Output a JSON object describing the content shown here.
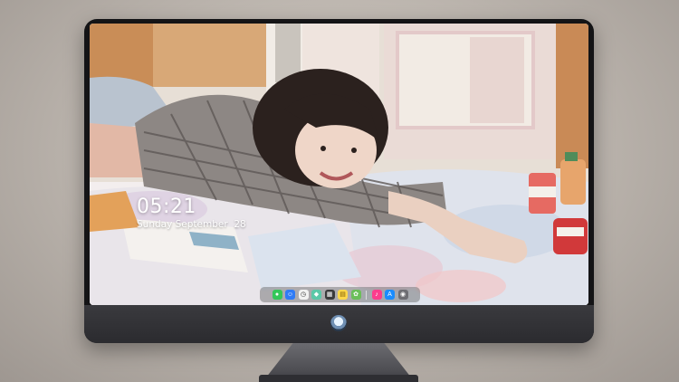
{
  "lock_screen": {
    "time": "05:21",
    "date": "Sunday September  28"
  },
  "dock": {
    "apps": [
      {
        "name": "messages-icon",
        "color": "#34c759",
        "glyph": "●"
      },
      {
        "name": "finder-icon",
        "color": "#2f7bf6",
        "glyph": "☺"
      },
      {
        "name": "clock-icon",
        "color": "#f2f2f2",
        "glyph": "◷"
      },
      {
        "name": "maps-icon",
        "color": "#5ac8a8",
        "glyph": "◆"
      },
      {
        "name": "calendar-icon",
        "color": "#3a3a3c",
        "glyph": "▦"
      },
      {
        "name": "notes-icon",
        "color": "#ffd84a",
        "glyph": "▤"
      },
      {
        "name": "photos-icon",
        "color": "#6bbf59",
        "glyph": "✿"
      },
      {
        "name": "music-icon",
        "color": "#fc3c8d",
        "glyph": "♪"
      },
      {
        "name": "app-store-icon",
        "color": "#1a8cff",
        "glyph": "A"
      },
      {
        "name": "camera-icon",
        "color": "#6e6e73",
        "glyph": "◉"
      }
    ]
  },
  "colors": {
    "monitor_bezel": "#141416",
    "monitor_chin": "#2b2b2f",
    "wallpaper_wall": "#e9e2da"
  }
}
